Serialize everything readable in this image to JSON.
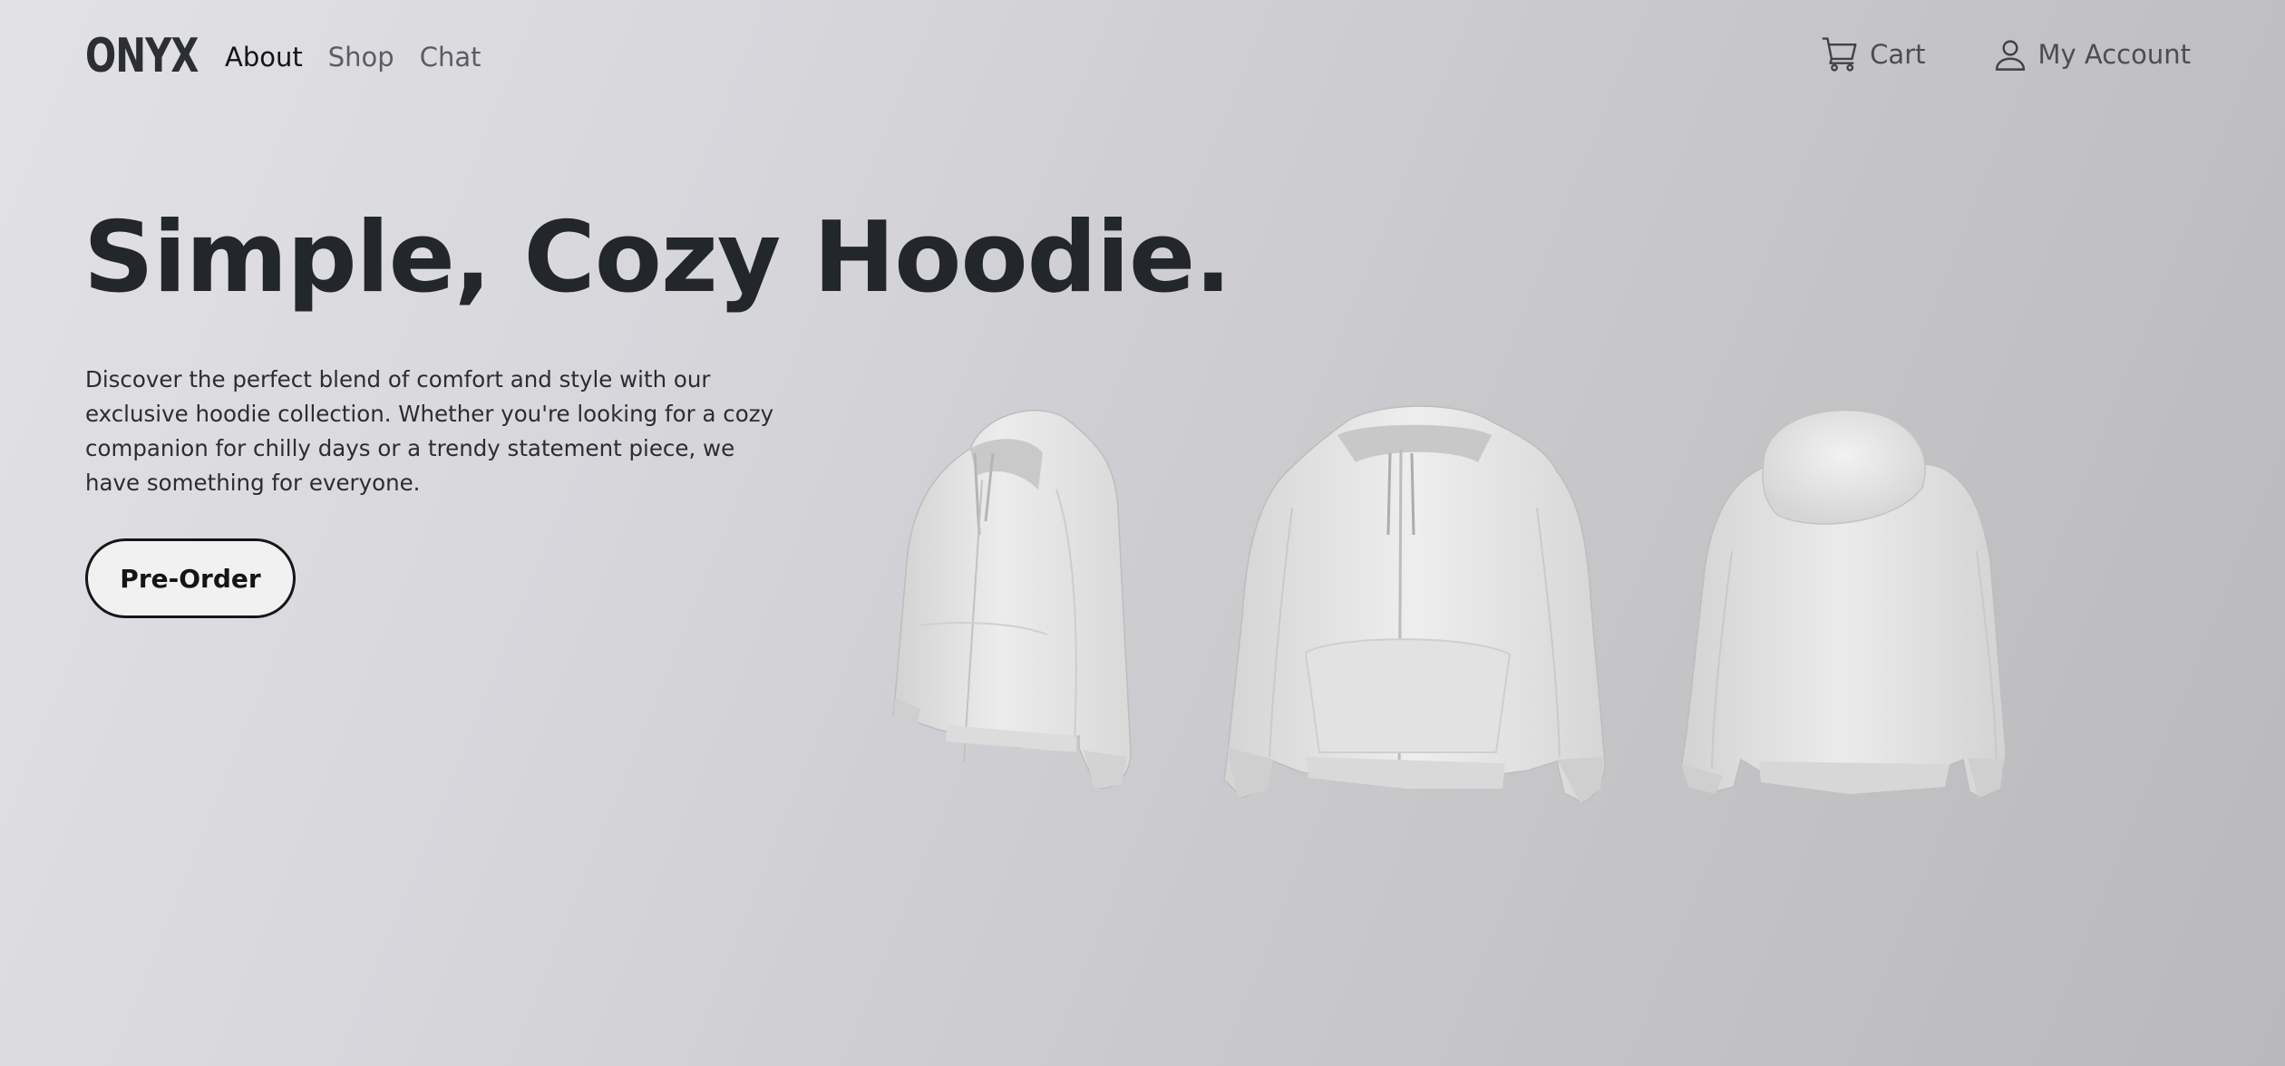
{
  "brand": {
    "logo": "ONYX"
  },
  "nav": {
    "links": [
      {
        "label": "About",
        "active": true
      },
      {
        "label": "Shop",
        "active": false
      },
      {
        "label": "Chat",
        "active": false
      }
    ],
    "cart_label": "Cart",
    "account_label": "My Account"
  },
  "hero": {
    "title": "Simple, Cozy Hoodie.",
    "description": "Discover the perfect blend of comfort and style with our exclusive hoodie collection. Whether you're looking for a cozy companion for chilly days or a trendy statement piece, we have something for everyone.",
    "cta_label": "Pre-Order"
  },
  "products": {
    "views": [
      "side",
      "front",
      "back"
    ]
  },
  "colors": {
    "text_dark": "#23262a",
    "nav_inactive": "#5a5d63",
    "hoodie": "#e6e6e6"
  },
  "icons": [
    "cart-icon",
    "user-icon"
  ]
}
